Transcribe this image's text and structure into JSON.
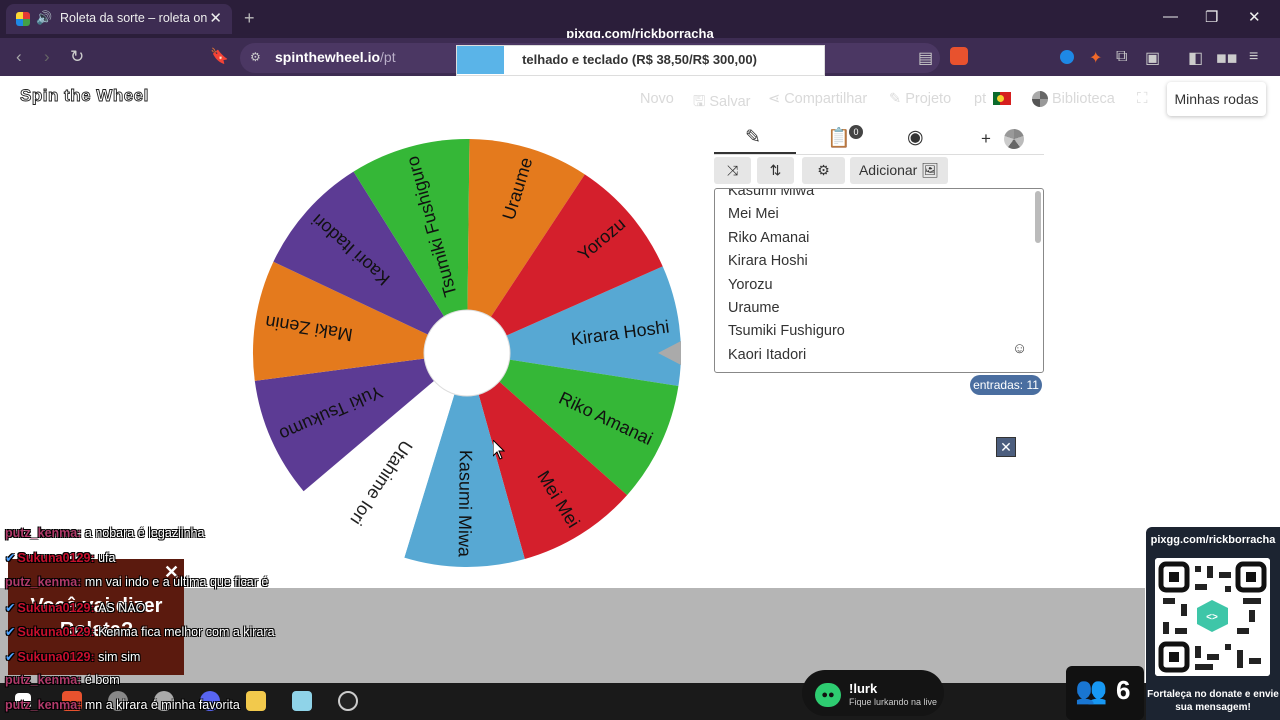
{
  "browser": {
    "tab_title": "Roleta da sorte – roleta onlin",
    "stream_url_banner": "pixgg.com/rickborracha",
    "address": {
      "host": "spinthewheel.io",
      "path": "/pt"
    },
    "donation_goal": "telhado e teclado (R$ 38,50/R$ 300,00)",
    "donation_progress": 0.128
  },
  "site": {
    "logo": "Spin the Wheel",
    "menu": {
      "new": "Novo",
      "save": "Salvar",
      "share": "Compartilhar",
      "project": "Projeto",
      "lang": "pt",
      "library": "Biblioteca",
      "my_wheels": "Minhas rodas"
    }
  },
  "wheel": {
    "segments": [
      {
        "label": "Kirara Hoshi",
        "color": "#57a8d3"
      },
      {
        "label": "Riko Amanai",
        "color": "#35b737"
      },
      {
        "label": "Mei Mei",
        "color": "#d41f2c"
      },
      {
        "label": "Kasumi Miwa",
        "color": "#57a8d3"
      },
      {
        "label": "Utahime Iori",
        "color": "#ffffff"
      },
      {
        "label": "Yuki Tsukumo",
        "color": "#5c3b94"
      },
      {
        "label": "Maki Zenin",
        "color": "#e47a1d"
      },
      {
        "label": "Kaori Itadori",
        "color": "#5c3b94"
      },
      {
        "label": "Tsumiki Fushiguro",
        "color": "#35b737"
      },
      {
        "label": "Uraume",
        "color": "#e47a1d"
      },
      {
        "label": "Yorozu",
        "color": "#d41f2c"
      }
    ]
  },
  "panel": {
    "notif_count": "0",
    "add_button": "Adicionar",
    "entries": [
      "Kasumi Miwa",
      "Mei Mei",
      "Riko Amanai",
      "Kirara Hoshi",
      "Yorozu",
      "Uraume",
      "Tsumiki Fushiguro",
      "Kaori Itadori"
    ],
    "entries_count": "entradas: 11"
  },
  "chat": [
    {
      "user": "putz_kenma",
      "msg": "a nobara é legaziinha",
      "verified": false
    },
    {
      "user": "Sukuna0129",
      "msg": "ufa",
      "verified": true
    },
    {
      "user": "putz_kenma",
      "msg": "mn vai indo e a última que ficar é",
      "verified": false
    },
    {
      "user": "Sukuna0129",
      "msg": "AS NAO",
      "verified": true
    },
    {
      "user": "Sukuna0129",
      "msg": "Kenma fica melhor com a kirara",
      "verified": true
    },
    {
      "user": "Sukuna0129",
      "msg": "sim sim",
      "verified": true
    },
    {
      "user": "putz_kenma",
      "msg": "é bom",
      "verified": false
    },
    {
      "user": "putz_kenma",
      "msg": "mn a kirara é minha favorita",
      "verified": false
    }
  ],
  "ad": {
    "text": "Você vai dizer Roleta?"
  },
  "lurk": {
    "title": "!lurk",
    "subtitle": "Fique lurkando na live"
  },
  "viewers": {
    "count": "6"
  },
  "qr": {
    "url": "pixgg.com/rickborracha",
    "message": "Fortaleça no donate e envie sua mensagem!"
  }
}
